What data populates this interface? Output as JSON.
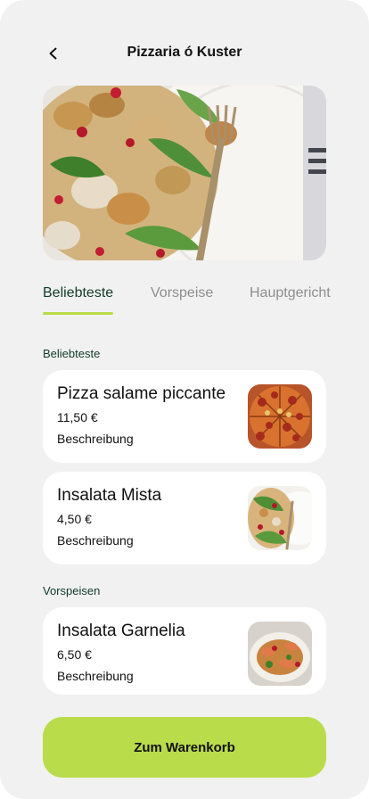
{
  "header": {
    "title": "Pizzaria ó Kuster",
    "back_icon": "chevron-left-icon"
  },
  "tabs": [
    {
      "label": "Beliebteste",
      "active": true
    },
    {
      "label": "Vorspeise",
      "active": false
    },
    {
      "label": "Hauptgericht",
      "active": false
    }
  ],
  "sections": [
    {
      "label": "Beliebteste",
      "items": [
        {
          "name": "Pizza salame piccante",
          "price": "11,50 €",
          "description": "Beschreibung"
        },
        {
          "name": "Insalata Mista",
          "price": "4,50 €",
          "description": "Beschreibung"
        }
      ]
    },
    {
      "label": "Vorspeisen",
      "items": [
        {
          "name": "Insalata Garnelia",
          "price": "6,50 €",
          "description": "Beschreibung"
        }
      ]
    }
  ],
  "cart_button": {
    "label": "Zum Warenkorb"
  },
  "colors": {
    "accent": "#b8dc4a",
    "background": "#f1f1f1",
    "dark_green": "#123b2a"
  }
}
